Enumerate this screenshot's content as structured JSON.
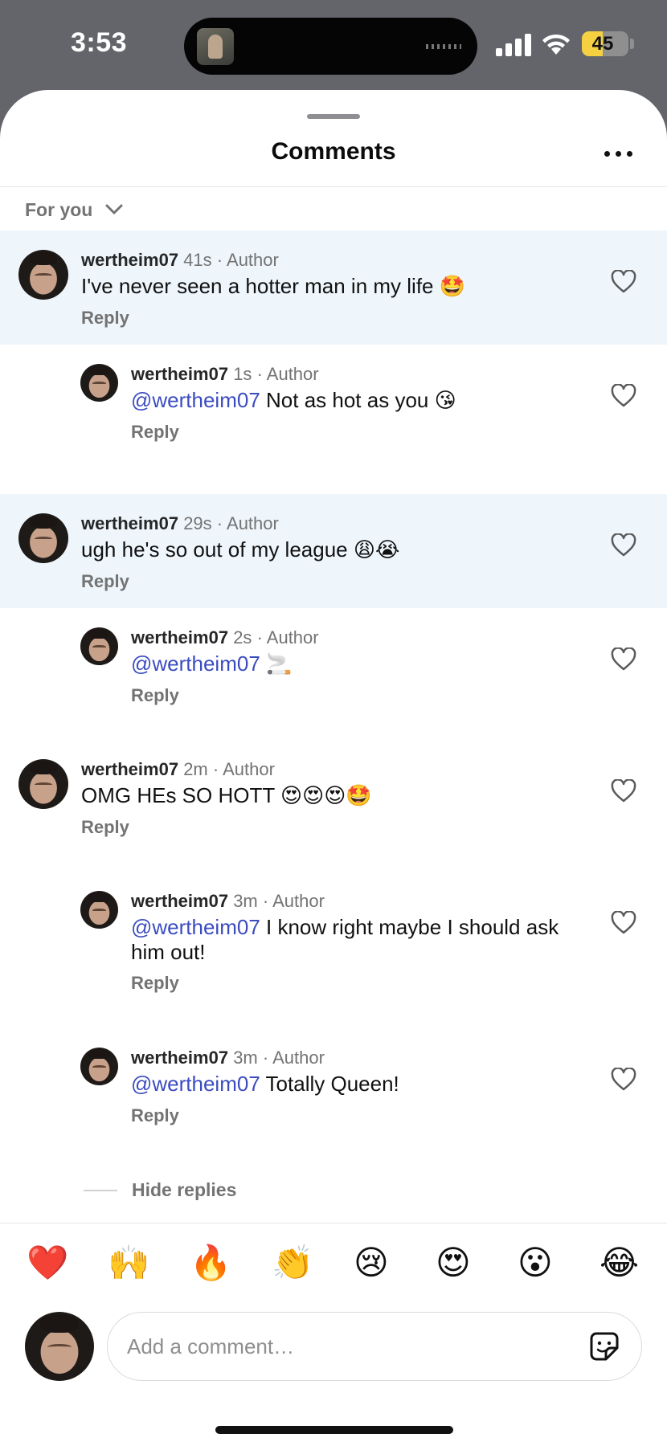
{
  "status_bar": {
    "time": "3:53",
    "battery_level": 45,
    "battery_label": "45",
    "colors": {
      "background": "#63656a",
      "battery_fill": "#f5d142"
    }
  },
  "sheet": {
    "title": "Comments",
    "more_icon": "more-horizontal-icon",
    "sort_label": "For you",
    "sort_icon": "chevron-down-icon"
  },
  "comments": [
    {
      "username": "wertheim07",
      "time": "41s",
      "role": "· Author",
      "mention": "",
      "text": "I've never seen a hotter man in my life ",
      "emoji": "🤩",
      "reply_label": "Reply",
      "highlighted": true,
      "is_reply": false
    },
    {
      "username": "wertheim07",
      "time": "1s",
      "role": "· Author",
      "mention": "@wertheim07",
      "text": " Not as hot as you ",
      "emoji": "😘",
      "reply_label": "Reply",
      "highlighted": false,
      "is_reply": true
    },
    {
      "username": "wertheim07",
      "time": "29s",
      "role": "· Author",
      "mention": "",
      "text": "ugh he's so out of my league ",
      "emoji": "😩😭",
      "reply_label": "Reply",
      "highlighted": true,
      "is_reply": false
    },
    {
      "username": "wertheim07",
      "time": "2s",
      "role": "· Author",
      "mention": "@wertheim07",
      "text": " ",
      "emoji": "🚬",
      "reply_label": "Reply",
      "highlighted": false,
      "is_reply": true
    },
    {
      "username": "wertheim07",
      "time": "2m",
      "role": "· Author",
      "mention": "",
      "text": "OMG HEs SO HOTT ",
      "emoji": "😍😍😍🤩",
      "reply_label": "Reply",
      "highlighted": false,
      "is_reply": false
    },
    {
      "username": "wertheim07",
      "time": "3m",
      "role": "· Author",
      "mention": "@wertheim07",
      "text": " I know right maybe I should ask him out!",
      "emoji": "",
      "reply_label": "Reply",
      "highlighted": false,
      "is_reply": true
    },
    {
      "username": "wertheim07",
      "time": "3m",
      "role": "· Author",
      "mention": "@wertheim07",
      "text": " Totally Queen!",
      "emoji": "",
      "reply_label": "Reply",
      "highlighted": false,
      "is_reply": true
    }
  ],
  "hide_replies_label": "Hide replies",
  "quick_reactions": [
    "❤️",
    "🙌",
    "🔥",
    "👏",
    "😢",
    "😍",
    "😮",
    "😂"
  ],
  "composer": {
    "placeholder": "Add a comment…",
    "sticker_icon": "sticker-icon"
  },
  "colors": {
    "highlight_background": "#eef6fc",
    "mention": "#3b4cc0",
    "secondary_text": "#737373"
  }
}
